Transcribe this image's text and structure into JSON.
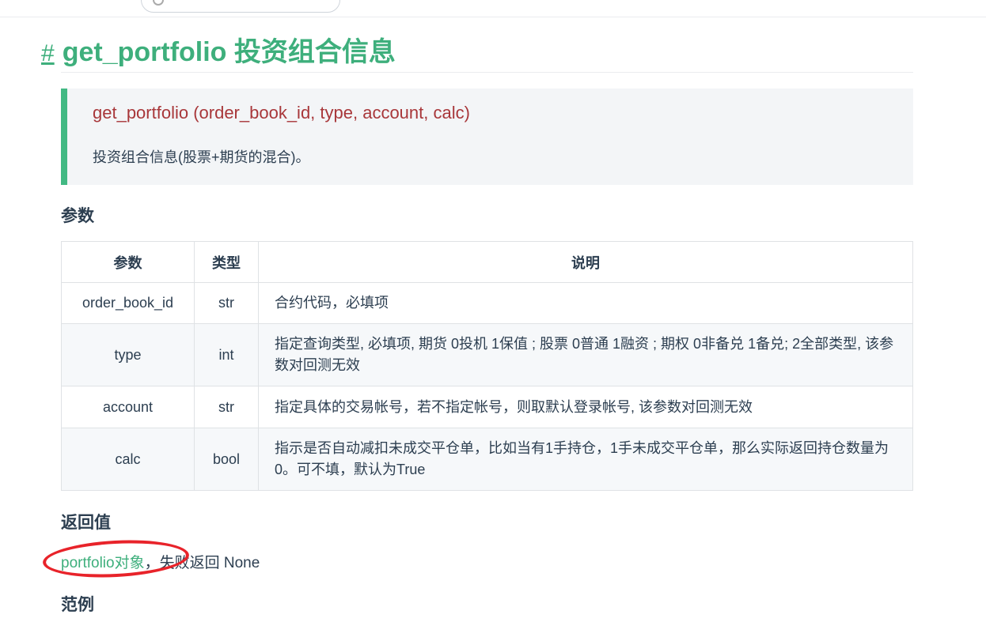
{
  "heading": {
    "anchor": "#",
    "title": "get_portfolio 投资组合信息"
  },
  "signature": {
    "text": "get_portfolio (order_book_id, type, account, calc)",
    "description": "投资组合信息(股票+期货的混合)。"
  },
  "params_heading": "参数",
  "params_table": {
    "headers": [
      "参数",
      "类型",
      "说明"
    ],
    "rows": [
      {
        "name": "order_book_id",
        "type": "str",
        "desc": "合约代码，必填项"
      },
      {
        "name": "type",
        "type": "int",
        "desc": "指定查询类型, 必填项, 期货 0投机 1保值 ; 股票 0普通 1融资 ; 期权 0非备兑 1备兑; 2全部类型, 该参数对回测无效"
      },
      {
        "name": "account",
        "type": "str",
        "desc": "指定具体的交易帐号，若不指定帐号，则取默认登录帐号, 该参数对回测无效"
      },
      {
        "name": "calc",
        "type": "bool",
        "desc": "指示是否自动减扣未成交平仓单，比如当有1手持仓，1手未成交平仓单，那么实际返回持仓数量为0。可不填，默认为True"
      }
    ]
  },
  "return_heading": "返回值",
  "return_value": {
    "link_text": "portfolio对象",
    "rest_text": "，失败返回 None"
  },
  "example_heading": "范例"
}
